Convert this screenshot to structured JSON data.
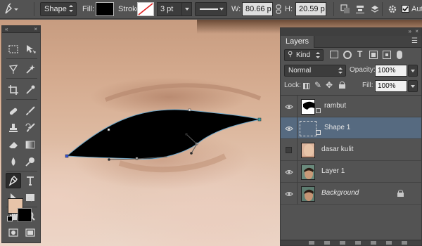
{
  "options_bar": {
    "tool_mode": "Shape",
    "fill_label": "Fill:",
    "fill_color": "#000000",
    "stroke_label": "Stroke:",
    "stroke_width": "3 pt",
    "width_label": "W:",
    "width_value": "80.66 p",
    "link_icon": "link-icon",
    "height_label": "H:",
    "height_value": "20.59 p",
    "auto_label": "Aut",
    "auto_checked": true
  },
  "tools_panel": {
    "foreground_color": "#e7c4a9",
    "background_color": "#000000",
    "tools": [
      "marquee",
      "move",
      "lasso",
      "magic-wand",
      "crop",
      "eyedropper",
      "healing-brush",
      "brush",
      "clone-stamp",
      "history-brush",
      "eraser",
      "gradient",
      "blur",
      "dodge",
      "pen",
      "type",
      "path-selection",
      "rectangle",
      "hand",
      "zoom"
    ],
    "active_tool": "pen"
  },
  "layers_panel": {
    "title": "Layers",
    "kind_filter": "Kind",
    "blend_mode": "Normal",
    "opacity_label": "Opacity:",
    "opacity_value": "100%",
    "lock_label": "Lock:",
    "fill_label": "Fill:",
    "fill_value": "100%",
    "selected_color": "#566a80",
    "layers": [
      {
        "name": "rambut",
        "visible": true,
        "italic": false,
        "selected": false
      },
      {
        "name": "Shape 1",
        "visible": true,
        "italic": false,
        "selected": true
      },
      {
        "name": "dasar kulit",
        "visible": false,
        "italic": false,
        "selected": false
      },
      {
        "name": "Layer 1",
        "visible": true,
        "italic": false,
        "selected": false
      },
      {
        "name": "Background",
        "visible": true,
        "italic": true,
        "selected": false,
        "locked": true
      }
    ]
  }
}
